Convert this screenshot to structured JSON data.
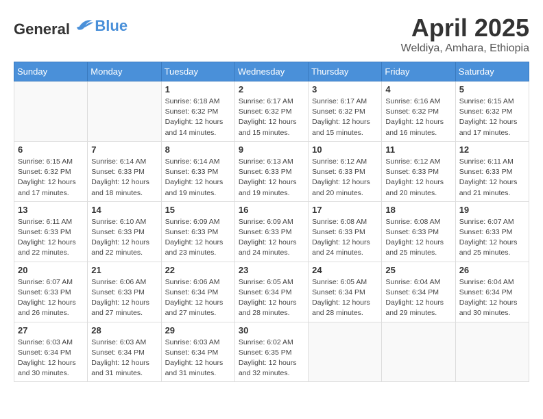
{
  "header": {
    "logo_general": "General",
    "logo_blue": "Blue",
    "month_year": "April 2025",
    "location": "Weldiya, Amhara, Ethiopia"
  },
  "days_of_week": [
    "Sunday",
    "Monday",
    "Tuesday",
    "Wednesday",
    "Thursday",
    "Friday",
    "Saturday"
  ],
  "weeks": [
    [
      {
        "day": "",
        "info": ""
      },
      {
        "day": "",
        "info": ""
      },
      {
        "day": "1",
        "info": "Sunrise: 6:18 AM\nSunset: 6:32 PM\nDaylight: 12 hours and 14 minutes."
      },
      {
        "day": "2",
        "info": "Sunrise: 6:17 AM\nSunset: 6:32 PM\nDaylight: 12 hours and 15 minutes."
      },
      {
        "day": "3",
        "info": "Sunrise: 6:17 AM\nSunset: 6:32 PM\nDaylight: 12 hours and 15 minutes."
      },
      {
        "day": "4",
        "info": "Sunrise: 6:16 AM\nSunset: 6:32 PM\nDaylight: 12 hours and 16 minutes."
      },
      {
        "day": "5",
        "info": "Sunrise: 6:15 AM\nSunset: 6:32 PM\nDaylight: 12 hours and 17 minutes."
      }
    ],
    [
      {
        "day": "6",
        "info": "Sunrise: 6:15 AM\nSunset: 6:32 PM\nDaylight: 12 hours and 17 minutes."
      },
      {
        "day": "7",
        "info": "Sunrise: 6:14 AM\nSunset: 6:33 PM\nDaylight: 12 hours and 18 minutes."
      },
      {
        "day": "8",
        "info": "Sunrise: 6:14 AM\nSunset: 6:33 PM\nDaylight: 12 hours and 19 minutes."
      },
      {
        "day": "9",
        "info": "Sunrise: 6:13 AM\nSunset: 6:33 PM\nDaylight: 12 hours and 19 minutes."
      },
      {
        "day": "10",
        "info": "Sunrise: 6:12 AM\nSunset: 6:33 PM\nDaylight: 12 hours and 20 minutes."
      },
      {
        "day": "11",
        "info": "Sunrise: 6:12 AM\nSunset: 6:33 PM\nDaylight: 12 hours and 20 minutes."
      },
      {
        "day": "12",
        "info": "Sunrise: 6:11 AM\nSunset: 6:33 PM\nDaylight: 12 hours and 21 minutes."
      }
    ],
    [
      {
        "day": "13",
        "info": "Sunrise: 6:11 AM\nSunset: 6:33 PM\nDaylight: 12 hours and 22 minutes."
      },
      {
        "day": "14",
        "info": "Sunrise: 6:10 AM\nSunset: 6:33 PM\nDaylight: 12 hours and 22 minutes."
      },
      {
        "day": "15",
        "info": "Sunrise: 6:09 AM\nSunset: 6:33 PM\nDaylight: 12 hours and 23 minutes."
      },
      {
        "day": "16",
        "info": "Sunrise: 6:09 AM\nSunset: 6:33 PM\nDaylight: 12 hours and 24 minutes."
      },
      {
        "day": "17",
        "info": "Sunrise: 6:08 AM\nSunset: 6:33 PM\nDaylight: 12 hours and 24 minutes."
      },
      {
        "day": "18",
        "info": "Sunrise: 6:08 AM\nSunset: 6:33 PM\nDaylight: 12 hours and 25 minutes."
      },
      {
        "day": "19",
        "info": "Sunrise: 6:07 AM\nSunset: 6:33 PM\nDaylight: 12 hours and 25 minutes."
      }
    ],
    [
      {
        "day": "20",
        "info": "Sunrise: 6:07 AM\nSunset: 6:33 PM\nDaylight: 12 hours and 26 minutes."
      },
      {
        "day": "21",
        "info": "Sunrise: 6:06 AM\nSunset: 6:33 PM\nDaylight: 12 hours and 27 minutes."
      },
      {
        "day": "22",
        "info": "Sunrise: 6:06 AM\nSunset: 6:34 PM\nDaylight: 12 hours and 27 minutes."
      },
      {
        "day": "23",
        "info": "Sunrise: 6:05 AM\nSunset: 6:34 PM\nDaylight: 12 hours and 28 minutes."
      },
      {
        "day": "24",
        "info": "Sunrise: 6:05 AM\nSunset: 6:34 PM\nDaylight: 12 hours and 28 minutes."
      },
      {
        "day": "25",
        "info": "Sunrise: 6:04 AM\nSunset: 6:34 PM\nDaylight: 12 hours and 29 minutes."
      },
      {
        "day": "26",
        "info": "Sunrise: 6:04 AM\nSunset: 6:34 PM\nDaylight: 12 hours and 30 minutes."
      }
    ],
    [
      {
        "day": "27",
        "info": "Sunrise: 6:03 AM\nSunset: 6:34 PM\nDaylight: 12 hours and 30 minutes."
      },
      {
        "day": "28",
        "info": "Sunrise: 6:03 AM\nSunset: 6:34 PM\nDaylight: 12 hours and 31 minutes."
      },
      {
        "day": "29",
        "info": "Sunrise: 6:03 AM\nSunset: 6:34 PM\nDaylight: 12 hours and 31 minutes."
      },
      {
        "day": "30",
        "info": "Sunrise: 6:02 AM\nSunset: 6:35 PM\nDaylight: 12 hours and 32 minutes."
      },
      {
        "day": "",
        "info": ""
      },
      {
        "day": "",
        "info": ""
      },
      {
        "day": "",
        "info": ""
      }
    ]
  ]
}
